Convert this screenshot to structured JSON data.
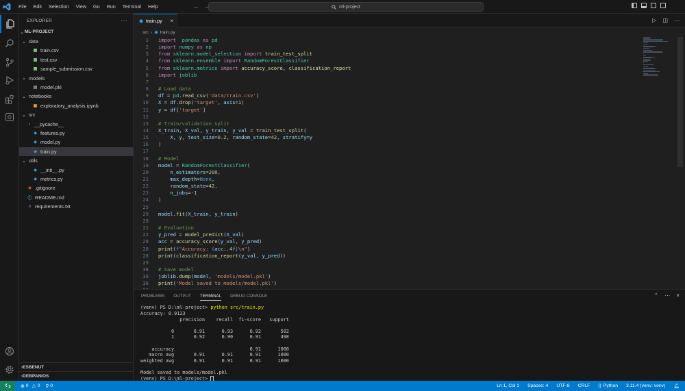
{
  "window": {
    "menu": [
      "File",
      "Edit",
      "Selection",
      "View",
      "Go",
      "Run",
      "Terminal",
      "Help"
    ],
    "search_text": "ml-project"
  },
  "sidebar": {
    "title": "EXPLORER",
    "project": "ML-PROJECT",
    "tree": [
      {
        "label": "data",
        "kind": "folder",
        "depth": 1
      },
      {
        "label": "train.csv",
        "kind": "csv",
        "depth": 2
      },
      {
        "label": "test.csv",
        "kind": "csv",
        "depth": 2
      },
      {
        "label": "sample_submission.csv",
        "kind": "csv",
        "depth": 2
      },
      {
        "label": "models",
        "kind": "folder",
        "depth": 1
      },
      {
        "label": "model.pkl",
        "kind": "file",
        "depth": 2
      },
      {
        "label": "notebooks",
        "kind": "folder",
        "depth": 1
      },
      {
        "label": "exploratory_analysis.ipynb",
        "kind": "ipynb",
        "depth": 2
      },
      {
        "label": "src",
        "kind": "folder",
        "depth": 1
      },
      {
        "label": "__pycache__",
        "kind": "folder-closed",
        "depth": 2
      },
      {
        "label": "features.py",
        "kind": "py",
        "depth": 2
      },
      {
        "label": "model.py",
        "kind": "py",
        "depth": 2
      },
      {
        "label": "train.py",
        "kind": "py",
        "depth": 2,
        "selected": true
      },
      {
        "label": "utils",
        "kind": "folder",
        "depth": 1
      },
      {
        "label": "__init__.py",
        "kind": "py",
        "depth": 2
      },
      {
        "label": "metrics.py",
        "kind": "py",
        "depth": 2
      },
      {
        "label": ".gitignore",
        "kind": "git",
        "depth": 1
      },
      {
        "label": "README.md",
        "kind": "md",
        "depth": 1
      },
      {
        "label": "requirements.txt",
        "kind": "txt",
        "depth": 1
      }
    ],
    "sections": [
      "ESBENUT",
      "DEBPANIOS"
    ]
  },
  "editor": {
    "tab_label": "train.py",
    "breadcrumb": [
      "src",
      "train.py"
    ],
    "lines": [
      {
        "n": "1",
        "t": [
          [
            "kw",
            "import"
          ],
          [
            "",
            "  "
          ],
          [
            "ty",
            "pandas"
          ],
          [
            "",
            " "
          ],
          [
            "kw",
            "as"
          ],
          [
            "",
            " "
          ],
          [
            "ty",
            "pd"
          ]
        ]
      },
      {
        "n": "2",
        "t": [
          [
            "kw",
            "import"
          ],
          [
            "",
            " "
          ],
          [
            "ty",
            "numpy"
          ],
          [
            "",
            " "
          ],
          [
            "kw",
            "as"
          ],
          [
            "",
            " "
          ],
          [
            "ty",
            "np"
          ]
        ]
      },
      {
        "n": "3",
        "t": [
          [
            "kw",
            "from"
          ],
          [
            "",
            " "
          ],
          [
            "ty",
            "sklearn.model_selection"
          ],
          [
            "",
            " "
          ],
          [
            "kw",
            "import"
          ],
          [
            "",
            " "
          ],
          [
            "fn",
            "train_test_split"
          ]
        ]
      },
      {
        "n": "4",
        "t": [
          [
            "kw",
            "from"
          ],
          [
            "",
            " "
          ],
          [
            "ty",
            "sklearn.ensemble"
          ],
          [
            "",
            " "
          ],
          [
            "kw",
            "import"
          ],
          [
            "",
            " "
          ],
          [
            "ty",
            "RandomForestClassifier"
          ]
        ]
      },
      {
        "n": "5",
        "t": [
          [
            "kw",
            "from"
          ],
          [
            "",
            " "
          ],
          [
            "ty",
            "sklearn.metrics"
          ],
          [
            "",
            " "
          ],
          [
            "kw",
            "import"
          ],
          [
            "",
            " "
          ],
          [
            "fn",
            "accuracy_score"
          ],
          [
            "",
            ", "
          ],
          [
            "fn",
            "classification_report"
          ]
        ]
      },
      {
        "n": "6",
        "t": [
          [
            "kw",
            "import"
          ],
          [
            "",
            " "
          ],
          [
            "ty",
            "joblib"
          ]
        ]
      },
      {
        "n": "7",
        "t": []
      },
      {
        "n": "8",
        "t": [
          [
            "cm",
            "# Load data"
          ]
        ]
      },
      {
        "n": "9",
        "t": [
          [
            "va",
            "df"
          ],
          [
            "",
            " = "
          ],
          [
            "ty",
            "pd"
          ],
          [
            "",
            "."
          ],
          [
            "fn",
            "read_csv"
          ],
          [
            "",
            "("
          ],
          [
            "st",
            "'data/train.csv'"
          ],
          [
            "",
            ")"
          ]
        ]
      },
      {
        "n": "10",
        "t": [
          [
            "va",
            "X"
          ],
          [
            "",
            " = "
          ],
          [
            "va",
            "df"
          ],
          [
            "",
            "."
          ],
          [
            "fn",
            "drop"
          ],
          [
            "",
            "("
          ],
          [
            "st",
            "'target'"
          ],
          [
            "",
            ", "
          ],
          [
            "va",
            "axis"
          ],
          [
            "",
            "="
          ],
          [
            "nu",
            "1"
          ],
          [
            "",
            ")"
          ]
        ]
      },
      {
        "n": "11",
        "t": [
          [
            "va",
            "y"
          ],
          [
            "",
            " = "
          ],
          [
            "va",
            "df"
          ],
          [
            "",
            "["
          ],
          [
            "st",
            "'target'"
          ],
          [
            "",
            "]"
          ]
        ]
      },
      {
        "n": "12",
        "t": []
      },
      {
        "n": "13",
        "t": [
          [
            "cm",
            "# Train/validation split"
          ]
        ]
      },
      {
        "n": "14",
        "t": [
          [
            "va",
            "X_train"
          ],
          [
            "",
            ", "
          ],
          [
            "va",
            "X_val"
          ],
          [
            "",
            ", "
          ],
          [
            "va",
            "y_train"
          ],
          [
            "",
            ", "
          ],
          [
            "va",
            "y_val"
          ],
          [
            "",
            " = "
          ],
          [
            "fn",
            "train_test_split"
          ],
          [
            "",
            "("
          ]
        ]
      },
      {
        "n": "15",
        "t": [
          [
            "",
            "    "
          ],
          [
            "va",
            "X"
          ],
          [
            "",
            ", "
          ],
          [
            "va",
            "y"
          ],
          [
            "",
            ", "
          ],
          [
            "va",
            "test_size"
          ],
          [
            "",
            "="
          ],
          [
            "nu",
            "0.2"
          ],
          [
            "",
            ", "
          ],
          [
            "va",
            "random_state"
          ],
          [
            "",
            "="
          ],
          [
            "nu",
            "42"
          ],
          [
            "",
            ", "
          ],
          [
            "va",
            "stratify"
          ],
          [
            "",
            "="
          ],
          [
            "va",
            "y"
          ]
        ]
      },
      {
        "n": "16",
        "t": [
          [
            "",
            ")"
          ]
        ]
      },
      {
        "n": "17",
        "t": []
      },
      {
        "n": "18",
        "t": [
          [
            "cm",
            "# Model"
          ]
        ]
      },
      {
        "n": "19",
        "t": [
          [
            "va",
            "model"
          ],
          [
            "",
            " = "
          ],
          [
            "ty",
            "RandomForestClassifier"
          ],
          [
            "",
            "("
          ]
        ]
      },
      {
        "n": "20",
        "t": [
          [
            "",
            "    "
          ],
          [
            "va",
            "n_estimators"
          ],
          [
            "",
            "="
          ],
          [
            "nu",
            "200"
          ],
          [
            "",
            ","
          ]
        ]
      },
      {
        "n": "21",
        "t": [
          [
            "",
            "    "
          ],
          [
            "va",
            "max_depth"
          ],
          [
            "",
            "="
          ],
          [
            "bi",
            "None"
          ],
          [
            "",
            ","
          ]
        ]
      },
      {
        "n": "22",
        "t": [
          [
            "",
            "    "
          ],
          [
            "va",
            "random_state"
          ],
          [
            "",
            "="
          ],
          [
            "nu",
            "42"
          ],
          [
            "",
            ","
          ]
        ]
      },
      {
        "n": "23",
        "t": [
          [
            "",
            "    "
          ],
          [
            "va",
            "n_jobs"
          ],
          [
            "",
            "=-"
          ],
          [
            "nu",
            "1"
          ]
        ]
      },
      {
        "n": "24",
        "t": [
          [
            "",
            ")"
          ]
        ]
      },
      {
        "n": "25",
        "t": []
      },
      {
        "n": "29",
        "t": [
          [
            "va",
            "model"
          ],
          [
            "",
            "."
          ],
          [
            "fn",
            "fit"
          ],
          [
            "",
            "("
          ],
          [
            "va",
            "X_train"
          ],
          [
            "",
            ", "
          ],
          [
            "va",
            "y_train"
          ],
          [
            "",
            ")"
          ]
        ]
      },
      {
        "n": "28",
        "t": []
      },
      {
        "n": "21",
        "t": [
          [
            "cm",
            "# Evaluation"
          ]
        ]
      },
      {
        "n": "22",
        "t": [
          [
            "va",
            "y_pred"
          ],
          [
            "",
            " = "
          ],
          [
            "fn",
            "model_predict"
          ],
          [
            "",
            "("
          ],
          [
            "va",
            "X_val"
          ],
          [
            "",
            ")"
          ]
        ]
      },
      {
        "n": "28",
        "t": [
          [
            "va",
            "acc"
          ],
          [
            "",
            " = "
          ],
          [
            "fn",
            "accuracy_score"
          ],
          [
            "",
            "("
          ],
          [
            "va",
            "y_val"
          ],
          [
            "",
            ", "
          ],
          [
            "va",
            "y_pred"
          ],
          [
            "",
            ")"
          ]
        ]
      },
      {
        "n": "20",
        "t": [
          [
            "fn",
            "print"
          ],
          [
            "",
            "("
          ],
          [
            "bi",
            "f"
          ],
          [
            "st",
            "\"Accuracy: "
          ],
          [
            "bi",
            "{"
          ],
          [
            "va",
            "acc"
          ],
          [
            "nu",
            ":.4f"
          ],
          [
            "bi",
            "}"
          ],
          [
            "st",
            "\\n\""
          ],
          [
            "",
            ")"
          ]
        ]
      },
      {
        "n": "28",
        "t": [
          [
            "fn",
            "print"
          ],
          [
            "",
            "("
          ],
          [
            "fn",
            "classification_report"
          ],
          [
            "",
            "("
          ],
          [
            "va",
            "y_val"
          ],
          [
            "",
            ", "
          ],
          [
            "va",
            "y_pred"
          ],
          [
            "",
            "))"
          ]
        ]
      },
      {
        "n": "29",
        "t": []
      },
      {
        "n": "38",
        "t": [
          [
            "cm",
            "# Save model"
          ]
        ]
      },
      {
        "n": "39",
        "t": [
          [
            "va",
            "joblib"
          ],
          [
            "",
            "."
          ],
          [
            "fn",
            "dump"
          ],
          [
            "",
            "("
          ],
          [
            "va",
            "model"
          ],
          [
            "",
            ", "
          ],
          [
            "st",
            "'models/model.pkl'"
          ],
          [
            "",
            ")"
          ]
        ]
      },
      {
        "n": "36",
        "t": [
          [
            "fn",
            "print"
          ],
          [
            "",
            "("
          ],
          [
            "st",
            "'Model saved to models/model.pkl'"
          ],
          [
            "",
            ")"
          ]
        ]
      },
      {
        "n": "38",
        "t": []
      }
    ]
  },
  "panel": {
    "tabs": [
      "PROBLEMS",
      "OUTPUT",
      "TERMINAL",
      "DEBUG CONSOLE"
    ],
    "active_tab": "TERMINAL",
    "prompt": "(venv) PS D:\\ml-project> ",
    "command": "python src/train.py",
    "output": [
      "Accuracy: 0.9123",
      "              precision    recall  f1-score   support",
      "",
      "           0       0.91      0.93      0.92       502",
      "           1       0.92      0.90      0.91       498",
      "",
      "    accuracy                           0.91      1000",
      "   macro avg       0.91      0.91      0.91      1000",
      "weighted avg       0.91      0.91      0.91      1000",
      "",
      "Model saved to models/model.pkl"
    ],
    "final_prompt": "(venv) PS D:\\ml-project> "
  },
  "statusbar": {
    "errors": "0",
    "warnings": "0",
    "ports": "0",
    "position": "Ln 1, Col 1",
    "spaces": "Spaces: 4",
    "encoding": "UTF-8",
    "eol": "CRLF",
    "language": "Python",
    "interpreter": "3.11.4 (venv: venv)"
  },
  "colors": {
    "accent": "#0078d4",
    "statusbar": "#007acc",
    "remote": "#16825d"
  }
}
